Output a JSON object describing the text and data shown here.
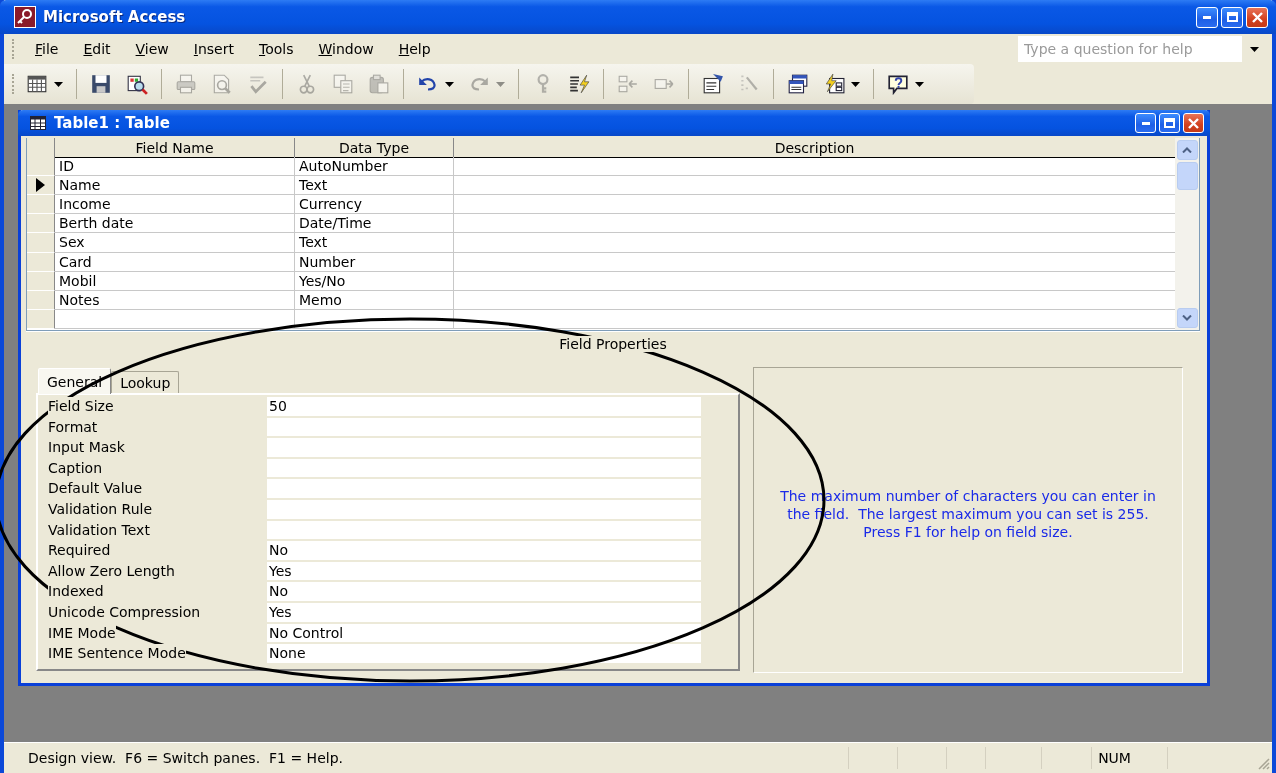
{
  "window": {
    "title": "Microsoft Access"
  },
  "menu": [
    {
      "label": "File"
    },
    {
      "label": "Edit"
    },
    {
      "label": "View"
    },
    {
      "label": "Insert"
    },
    {
      "label": "Tools"
    },
    {
      "label": "Window"
    },
    {
      "label": "Help"
    }
  ],
  "help_search": {
    "placeholder": "Type a question for help"
  },
  "toolbar": [
    [
      {
        "disabled": false,
        "dropdown": true
      }
    ],
    [
      {
        "disabled": false
      },
      {
        "disabled": false
      }
    ],
    [
      {
        "disabled": true
      },
      {
        "disabled": true
      },
      {
        "disabled": true
      }
    ],
    [
      {
        "disabled": true
      },
      {
        "disabled": true
      },
      {
        "disabled": true
      }
    ],
    [
      {
        "disabled": false,
        "dropdown": true
      },
      {
        "disabled": true,
        "dropdown": true
      }
    ],
    [
      {
        "disabled": true
      },
      {
        "disabled": false
      }
    ],
    [
      {
        "disabled": true
      },
      {
        "disabled": true
      }
    ],
    [
      {
        "disabled": false
      },
      {
        "disabled": true
      }
    ],
    [
      {
        "disabled": false
      },
      {
        "disabled": false,
        "dropdown": true
      }
    ],
    [
      {
        "disabled": false,
        "dropdown": true
      }
    ]
  ],
  "document": {
    "title": "Table1 : Table",
    "columns": [
      "Field Name",
      "Data Type",
      "Description"
    ],
    "rows": [
      {
        "field_name": "ID",
        "data_type": "AutoNumber",
        "selected": false
      },
      {
        "field_name": "Name",
        "data_type": "Text",
        "selected": true
      },
      {
        "field_name": "Income",
        "data_type": "Currency",
        "selected": false
      },
      {
        "field_name": "Berth date",
        "data_type": "Date/Time",
        "selected": false
      },
      {
        "field_name": "Sex",
        "data_type": "Text",
        "selected": false
      },
      {
        "field_name": "Card",
        "data_type": "Number",
        "selected": false
      },
      {
        "field_name": "Mobil",
        "data_type": "Yes/No",
        "selected": false
      },
      {
        "field_name": "Notes",
        "data_type": "Memo",
        "selected": false
      }
    ]
  },
  "field_properties": {
    "title": "Field Properties",
    "tabs": [
      {
        "label": "General",
        "selected": true
      },
      {
        "label": "Lookup",
        "selected": false
      }
    ],
    "properties": [
      {
        "label": "Field Size",
        "value": "50"
      },
      {
        "label": "Format"
      },
      {
        "label": "Input Mask"
      },
      {
        "label": "Caption"
      },
      {
        "label": "Default Value"
      },
      {
        "label": "Validation Rule"
      },
      {
        "label": "Validation Text"
      },
      {
        "label": "Required",
        "value": "No"
      },
      {
        "label": "Allow Zero Length",
        "value": "Yes"
      },
      {
        "label": "Indexed",
        "value": "No"
      },
      {
        "label": "Unicode Compression",
        "value": "Yes"
      },
      {
        "label": "IME Mode",
        "value": "No Control"
      },
      {
        "label": "IME Sentence Mode",
        "value": "None"
      }
    ],
    "help_text": "The maximum number of characters you can enter in the field.  The largest maximum you can set is 255.  Press F1 for help on field size."
  },
  "status_bar": {
    "message": "Design view.  F6 = Switch panes.  F1 = Help.",
    "indicators": [
      "NUM"
    ]
  }
}
